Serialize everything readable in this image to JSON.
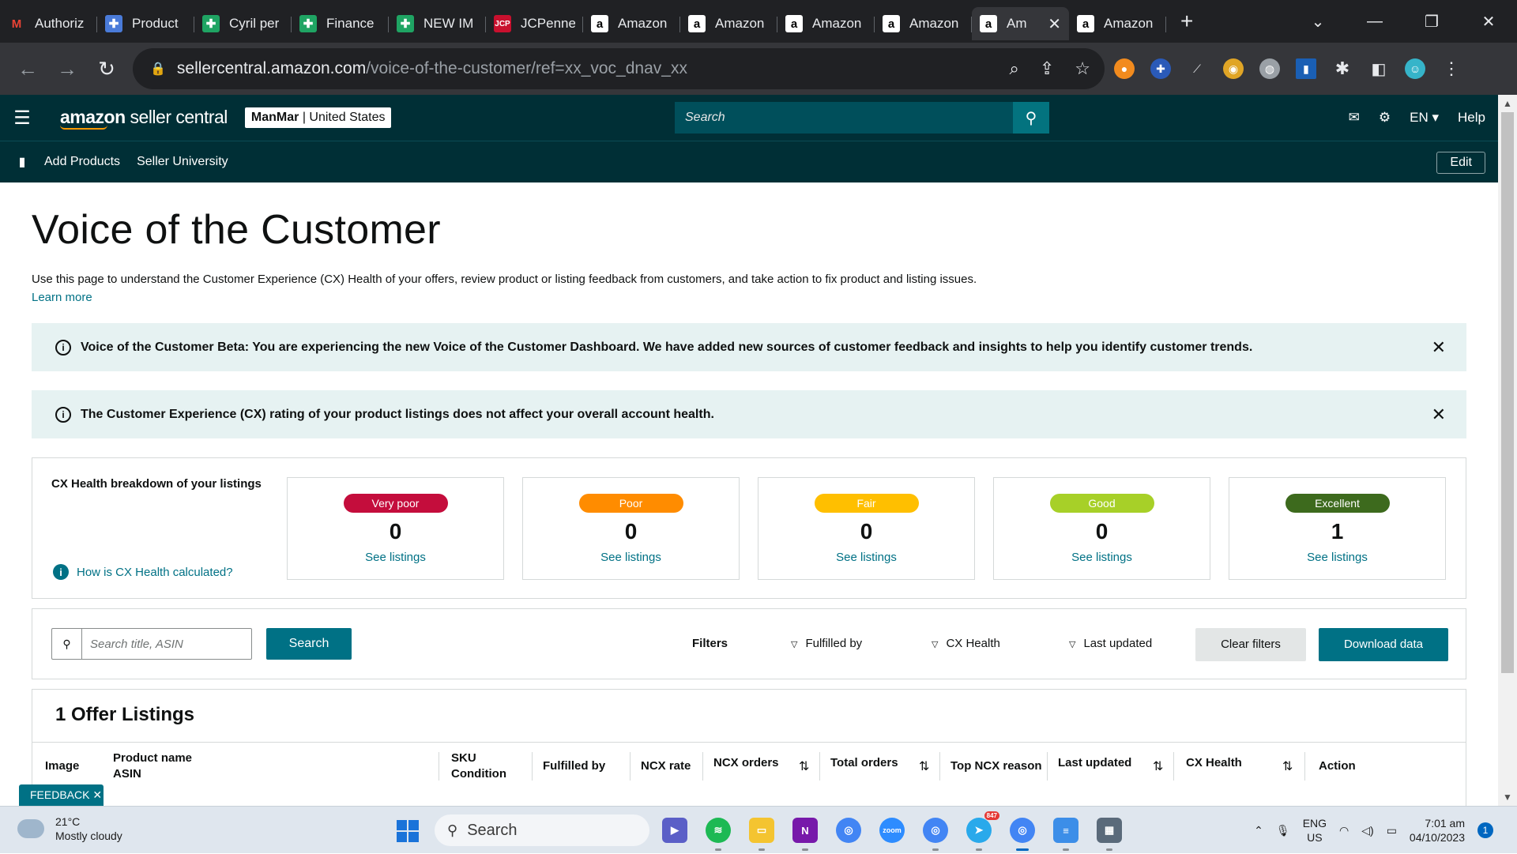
{
  "browser": {
    "tabs": [
      {
        "title": "Authoriz",
        "icon": "gmail-icon",
        "fav": "M",
        "color": "#ea4335",
        "bg": "transparent"
      },
      {
        "title": "Product",
        "icon": "product-icon",
        "fav": "✚",
        "color": "#ffffff",
        "bg": "#4a7bd9"
      },
      {
        "title": "Cyril per",
        "icon": "sheets-icon",
        "fav": "✚",
        "color": "#ffffff",
        "bg": "#1fa463"
      },
      {
        "title": "Finance",
        "icon": "sheets-icon",
        "fav": "✚",
        "color": "#ffffff",
        "bg": "#1fa463"
      },
      {
        "title": "NEW IM",
        "icon": "sheets-icon",
        "fav": "✚",
        "color": "#ffffff",
        "bg": "#1fa463"
      },
      {
        "title": "JCPenne",
        "icon": "jcp-icon",
        "fav": "JCP",
        "color": "#ffffff",
        "bg": "#c8102e"
      },
      {
        "title": "Amazon",
        "icon": "amazon-icon",
        "fav": "a",
        "color": "#000000",
        "bg": "#ffffff"
      },
      {
        "title": "Amazon",
        "icon": "amazon-icon",
        "fav": "a",
        "color": "#000000",
        "bg": "#ffffff"
      },
      {
        "title": "Amazon",
        "icon": "amazon-icon",
        "fav": "a",
        "color": "#000000",
        "bg": "#ffffff"
      },
      {
        "title": "Amazon",
        "icon": "amazon-icon",
        "fav": "a",
        "color": "#000000",
        "bg": "#ffffff"
      },
      {
        "title": "Am",
        "icon": "amazon-icon",
        "fav": "a",
        "color": "#000000",
        "bg": "#ffffff",
        "active": true
      },
      {
        "title": "Amazon",
        "icon": "amazon-icon",
        "fav": "a",
        "color": "#000000",
        "bg": "#ffffff"
      }
    ],
    "url_host": "sellercentral.amazon.com",
    "url_path": "/voice-of-the-customer/ref=xx_voc_dnav_xx"
  },
  "header": {
    "logo_bold": "amazon",
    "logo_rest": " seller central",
    "account_name": "ManMar",
    "account_region": " | United States",
    "search_placeholder": "Search",
    "language": "EN",
    "help": "Help"
  },
  "nav": {
    "links": [
      "Add Products",
      "Seller University"
    ],
    "edit": "Edit"
  },
  "page": {
    "title": "Voice of the Customer",
    "intro": "Use this page to understand the Customer Experience (CX) Health of your offers, review product or listing feedback from customers, and take action to fix product and listing issues.",
    "learn_more": "Learn more",
    "alert1": "Voice of the Customer Beta: You are experiencing the new Voice of the Customer Dashboard. We have added new sources of customer feedback and insights to help you identify customer trends.",
    "alert2": "The Customer Experience (CX) rating of your product listings does not affect your overall account health."
  },
  "cx": {
    "label": "CX Health breakdown of your listings",
    "how": "How is CX Health calculated?",
    "cards": [
      {
        "label": "Very poor",
        "count": "0",
        "link": "See listings",
        "color": "#c40d3c"
      },
      {
        "label": "Poor",
        "count": "0",
        "link": "See listings",
        "color": "#ff8c00"
      },
      {
        "label": "Fair",
        "count": "0",
        "link": "See listings",
        "color": "#ffbf00"
      },
      {
        "label": "Good",
        "count": "0",
        "link": "See listings",
        "color": "#a7d028"
      },
      {
        "label": "Excellent",
        "count": "1",
        "link": "See listings",
        "color": "#3d6a1d"
      }
    ]
  },
  "filters": {
    "search_placeholder": "Search title, ASIN",
    "search_button": "Search",
    "label": "Filters",
    "dropdowns": [
      "Fulfilled by",
      "CX Health",
      "Last updated"
    ],
    "clear": "Clear filters",
    "download": "Download data"
  },
  "listing": {
    "title": "1 Offer Listings",
    "columns": {
      "image": "Image",
      "product_name": "Product name",
      "asin": "ASIN",
      "sku": "SKU",
      "condition": "Condition",
      "fulfilled_by": "Fulfilled by",
      "ncx_rate": "NCX rate",
      "ncx_orders": "NCX orders",
      "total_orders": "Total orders",
      "top_ncx_reason": "Top NCX reason",
      "last_updated": "Last updated",
      "cx_health": "CX Health",
      "action": "Action"
    }
  },
  "feedback": "FEEDBACK",
  "taskbar": {
    "temp": "21°C",
    "weather": "Mostly cloudy",
    "search": "Search",
    "lang1": "ENG",
    "lang2": "US",
    "time": "7:01 am",
    "date": "04/10/2023",
    "notifications": "1",
    "telegram_badge": "847"
  }
}
